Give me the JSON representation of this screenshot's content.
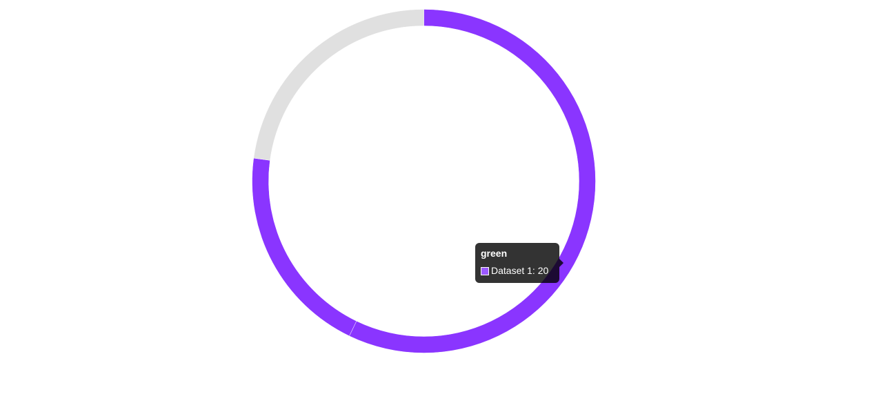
{
  "chart_data": {
    "type": "pie",
    "variant": "doughnut",
    "start_angle_deg": 0,
    "series": [
      {
        "name": "Dataset 1",
        "values": [
          {
            "value": 20,
            "color": "#8a35ff"
          },
          {
            "value": 7,
            "color": "#8a35ff"
          },
          {
            "value": 8,
            "color": "#e0e0e0"
          }
        ]
      }
    ],
    "tooltip": {
      "title": "green",
      "label": "Dataset 1: 20",
      "swatch_color": "#9b59ff"
    }
  }
}
